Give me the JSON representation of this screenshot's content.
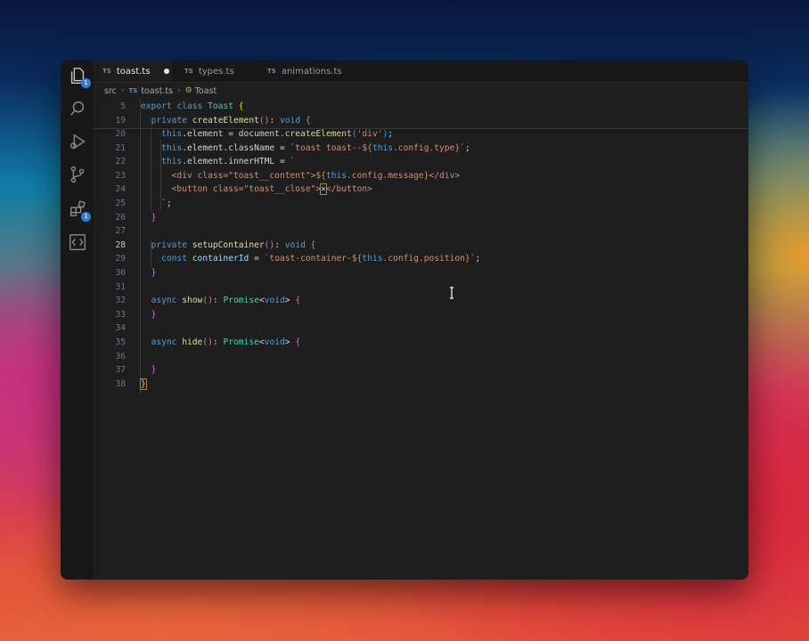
{
  "tabs": [
    {
      "label": "toast.ts",
      "lang": "TS",
      "modified": true,
      "active": true
    },
    {
      "label": "types.ts",
      "lang": "TS",
      "modified": false,
      "active": false
    },
    {
      "label": "animations.ts",
      "lang": "TS",
      "modified": false,
      "active": false
    }
  ],
  "breadcrumb": {
    "folder": "src",
    "file": "toast.ts",
    "file_lang": "TS",
    "symbol": "Toast"
  },
  "activity_bar": {
    "explorer_badge": "1",
    "extensions_badge": "1",
    "icons": [
      "files-icon",
      "search-icon",
      "run-debug-icon",
      "source-control-icon",
      "extensions-icon",
      "remote-icon"
    ]
  },
  "editor": {
    "sticky": [
      {
        "n": "5",
        "segments": [
          [
            "kb",
            "export "
          ],
          [
            "kb",
            "class "
          ],
          [
            "cls",
            "Toast "
          ],
          [
            "br1",
            "{"
          ]
        ]
      },
      {
        "n": "19",
        "segments": [
          [
            "",
            "  "
          ],
          [
            "kb",
            "private "
          ],
          [
            "fn",
            "createElement"
          ],
          [
            "br2",
            "()"
          ],
          [
            "",
            ": "
          ],
          [
            "kb",
            "void "
          ],
          [
            "br2",
            "{"
          ]
        ]
      }
    ],
    "lines": [
      {
        "n": "20",
        "segments": [
          [
            "",
            "    "
          ],
          [
            "kb",
            "this"
          ],
          [
            "",
            ".element = document."
          ],
          [
            "fn",
            "createElement"
          ],
          [
            "br3",
            "("
          ],
          [
            "str",
            "'div'"
          ],
          [
            "br3",
            ")"
          ],
          [
            "",
            ";"
          ]
        ]
      },
      {
        "n": "21",
        "segments": [
          [
            "",
            "    "
          ],
          [
            "kb",
            "this"
          ],
          [
            "",
            ".element.className = "
          ],
          [
            "str",
            "`toast toast--${"
          ],
          [
            "kb",
            "this"
          ],
          [
            "str",
            ".config.type}`"
          ],
          [
            "",
            ";"
          ]
        ]
      },
      {
        "n": "22",
        "segments": [
          [
            "",
            "    "
          ],
          [
            "kb",
            "this"
          ],
          [
            "",
            ".element.innerHTML = "
          ],
          [
            "str",
            "`"
          ]
        ]
      },
      {
        "n": "23",
        "segments": [
          [
            "",
            "      "
          ],
          [
            "str",
            "<div class=\"toast__content\">${"
          ],
          [
            "kb",
            "this"
          ],
          [
            "str",
            ".config.message}</div>"
          ]
        ]
      },
      {
        "n": "24",
        "segments": [
          [
            "",
            "      "
          ],
          [
            "str",
            "<button class=\"toast__close\">"
          ],
          [
            "bx",
            "×"
          ],
          [
            "str",
            "</button>"
          ]
        ]
      },
      {
        "n": "25",
        "segments": [
          [
            "",
            "    "
          ],
          [
            "str",
            "`"
          ],
          [
            "",
            ";"
          ]
        ]
      },
      {
        "n": "26",
        "segments": [
          [
            "",
            "  "
          ],
          [
            "br2",
            "}"
          ]
        ]
      },
      {
        "n": "27",
        "segments": [
          [
            "",
            ""
          ]
        ]
      },
      {
        "n": "28",
        "cur": true,
        "segments": [
          [
            "",
            "  "
          ],
          [
            "kb",
            "private "
          ],
          [
            "fn",
            "setupContainer"
          ],
          [
            "br2",
            "()"
          ],
          [
            "",
            ": "
          ],
          [
            "kb",
            "void "
          ],
          [
            "br2",
            "{"
          ]
        ]
      },
      {
        "n": "29",
        "segments": [
          [
            "",
            "    "
          ],
          [
            "kb",
            "const "
          ],
          [
            "var",
            "containerId"
          ],
          [
            "",
            " = "
          ],
          [
            "str",
            "`toast-container-${"
          ],
          [
            "kb",
            "this"
          ],
          [
            "str",
            ".config.position}`"
          ],
          [
            "",
            ";"
          ]
        ]
      },
      {
        "n": "30",
        "segments": [
          [
            "",
            "  "
          ],
          [
            "br2",
            "}"
          ]
        ]
      },
      {
        "n": "31",
        "segments": [
          [
            "",
            ""
          ]
        ]
      },
      {
        "n": "32",
        "segments": [
          [
            "",
            "  "
          ],
          [
            "kb",
            "async "
          ],
          [
            "fn",
            "show"
          ],
          [
            "br2",
            "()"
          ],
          [
            "",
            ": "
          ],
          [
            "cls",
            "Promise"
          ],
          [
            "",
            "<"
          ],
          [
            "kb",
            "void"
          ],
          [
            "",
            "> "
          ],
          [
            "br2",
            "{"
          ]
        ]
      },
      {
        "n": "33",
        "segments": [
          [
            "",
            "  "
          ],
          [
            "br2",
            "}"
          ]
        ]
      },
      {
        "n": "34",
        "segments": [
          [
            "",
            ""
          ]
        ]
      },
      {
        "n": "35",
        "segments": [
          [
            "",
            "  "
          ],
          [
            "kb",
            "async "
          ],
          [
            "fn",
            "hide"
          ],
          [
            "br2",
            "()"
          ],
          [
            "",
            ": "
          ],
          [
            "cls",
            "Promise"
          ],
          [
            "",
            "<"
          ],
          [
            "kb",
            "void"
          ],
          [
            "",
            "> "
          ],
          [
            "br2",
            "{"
          ]
        ]
      },
      {
        "n": "36",
        "segments": [
          [
            "",
            ""
          ]
        ]
      },
      {
        "n": "37",
        "segments": [
          [
            "",
            "  "
          ],
          [
            "br2",
            "}"
          ]
        ]
      },
      {
        "n": "38",
        "segments": [
          [
            "bx br1",
            "}"
          ]
        ]
      }
    ]
  }
}
